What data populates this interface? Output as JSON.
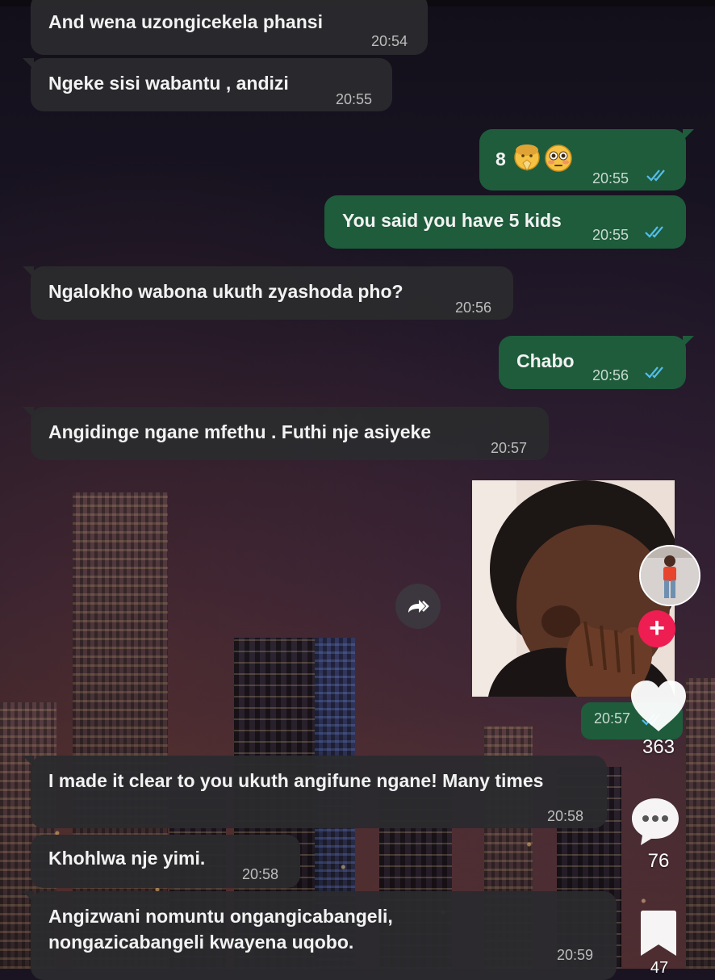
{
  "messages": [
    {
      "text": "And wena uzongicekela phansi",
      "time": "20:54",
      "direction": "incoming"
    },
    {
      "text": "Ngeke sisi wabantu , andizi",
      "time": "20:55",
      "direction": "incoming"
    },
    {
      "text": "8",
      "emojis": [
        "praying-face-emoji",
        "flushed-face-emoji"
      ],
      "time": "20:55",
      "direction": "outgoing",
      "status": "read"
    },
    {
      "text": "You said you have 5 kids",
      "time": "20:55",
      "direction": "outgoing",
      "status": "read"
    },
    {
      "text": "Ngalokho wabona ukuth zyashoda pho?",
      "time": "20:56",
      "direction": "incoming"
    },
    {
      "text": "Chabo",
      "time": "20:56",
      "direction": "outgoing",
      "status": "read"
    },
    {
      "text": "Angidinge ngane mfethu . Futhi nje asiyeke",
      "time": "20:57",
      "direction": "incoming"
    },
    {
      "type": "image",
      "description": "child covering face",
      "time": "20:57",
      "direction": "outgoing",
      "status": "read"
    },
    {
      "text": "I made it clear to you ukuth angifune ngane! Many times",
      "time": "20:58",
      "direction": "incoming"
    },
    {
      "text": "Khohlwa nje yimi.",
      "time": "20:58",
      "direction": "incoming"
    },
    {
      "text_line1": "Angizwani nomuntu ongangicabangeli,",
      "text_line2": "nongazicabangeli kwayena uqobo.",
      "time": "20:59",
      "direction": "incoming"
    }
  ],
  "overlay": {
    "likes": "363",
    "comments": "76",
    "saves": "47",
    "follow_label": "+"
  },
  "colors": {
    "incoming_bubble": "#2b2b2e",
    "outgoing_bubble": "#1e5c3c",
    "read_ticks": "#53bdeb",
    "follow_button": "#ee1d52"
  }
}
